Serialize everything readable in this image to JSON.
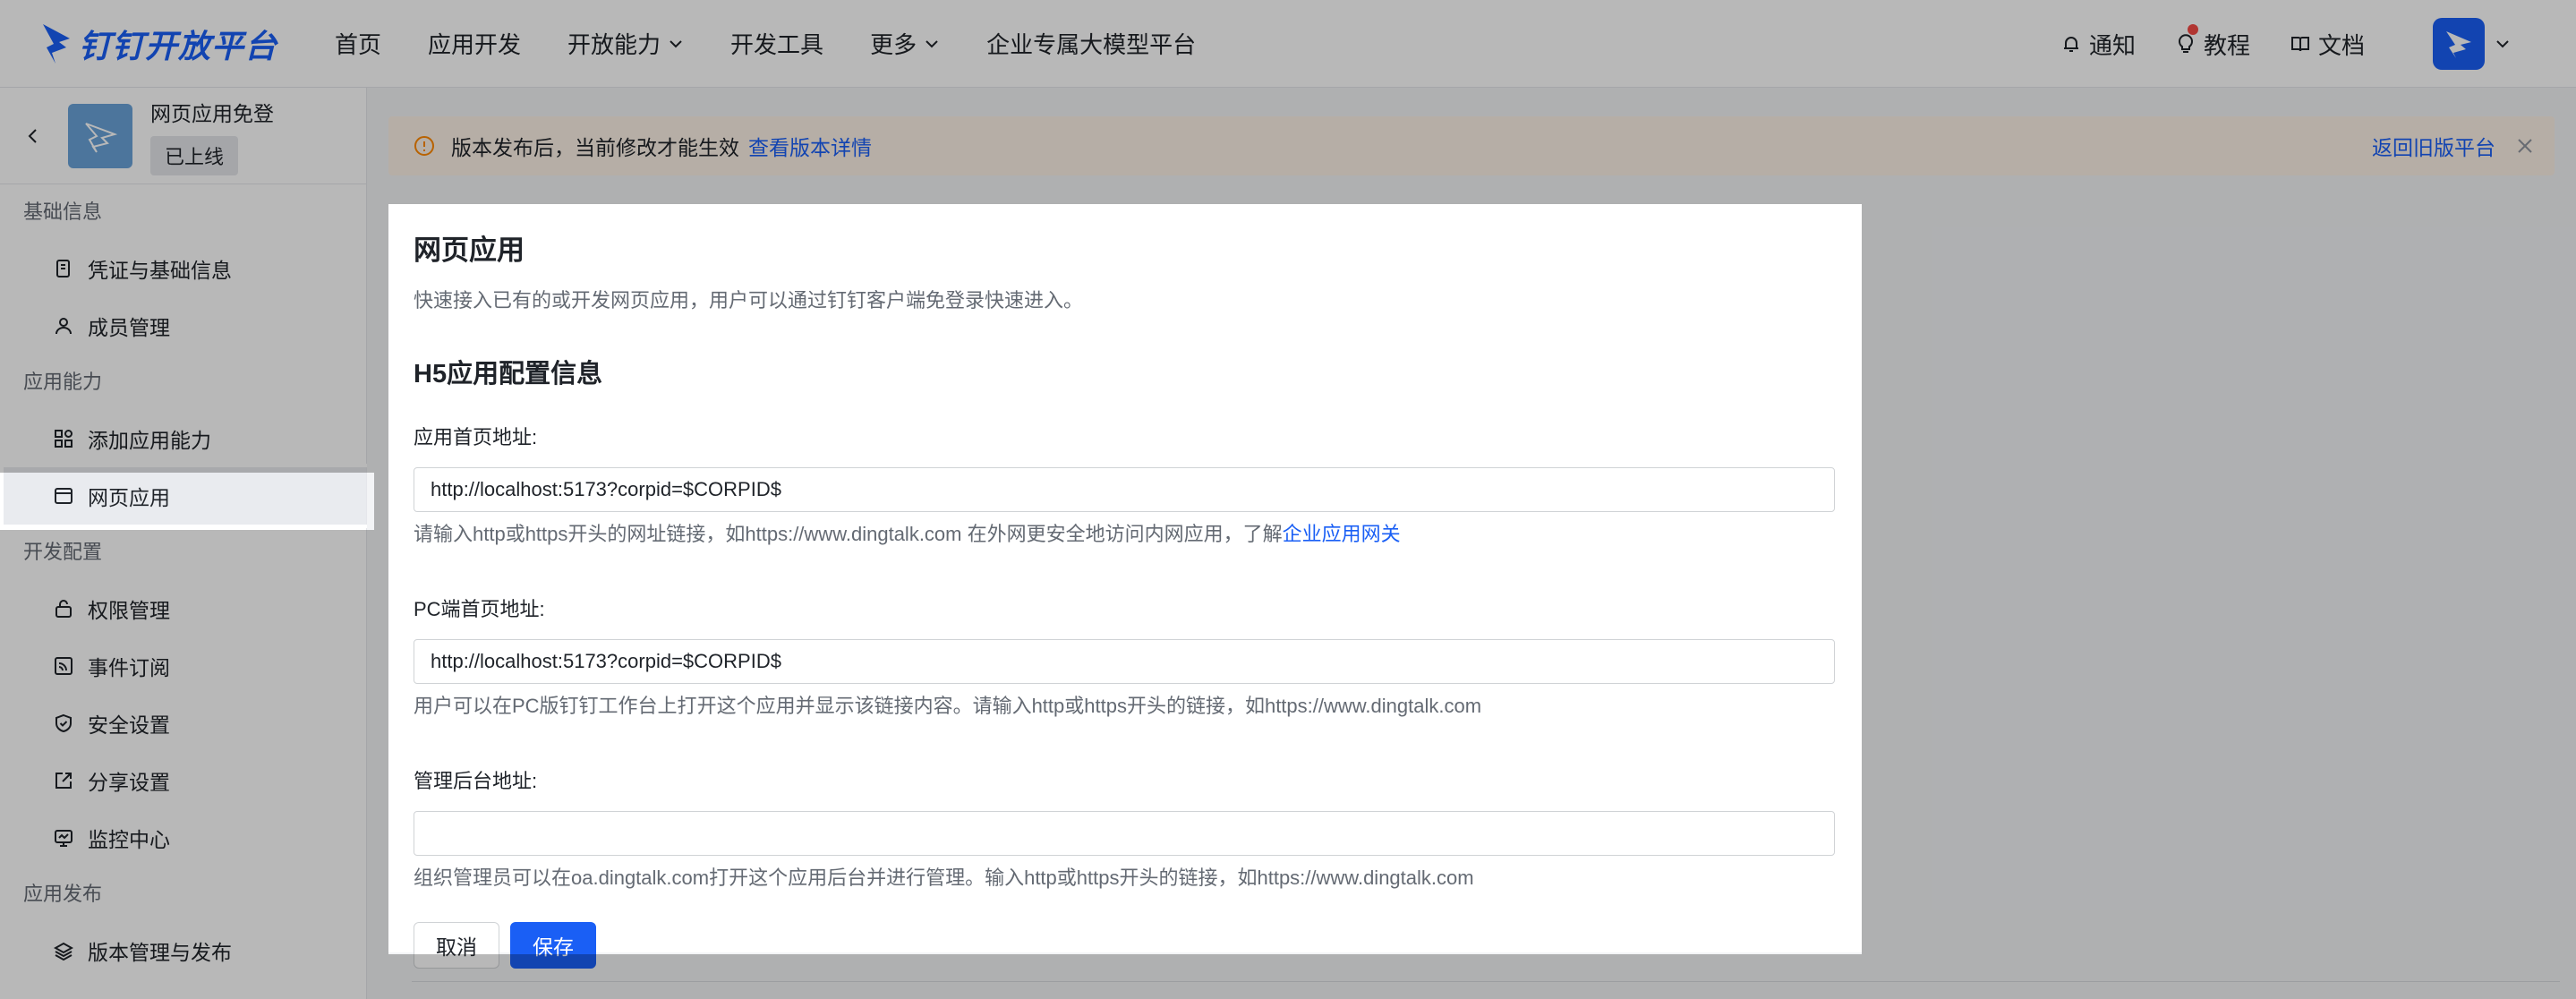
{
  "brand": {
    "name": "钉钉开放平台",
    "color": "#1a5ff5"
  },
  "nav": {
    "items": [
      {
        "label": "首页",
        "has_dropdown": false
      },
      {
        "label": "应用开发",
        "has_dropdown": false
      },
      {
        "label": "开放能力",
        "has_dropdown": true
      },
      {
        "label": "开发工具",
        "has_dropdown": false
      },
      {
        "label": "更多",
        "has_dropdown": true
      },
      {
        "label": "企业专属大模型平台",
        "has_dropdown": false
      }
    ],
    "right": {
      "notify": "通知",
      "tutorial": "教程",
      "docs": "文档"
    }
  },
  "app": {
    "name": "网页应用免登",
    "status": "已上线"
  },
  "sidebar": {
    "groups": [
      {
        "title": "基础信息",
        "items": [
          {
            "label": "凭证与基础信息",
            "icon": "credential-icon"
          },
          {
            "label": "成员管理",
            "icon": "user-icon"
          }
        ]
      },
      {
        "title": "应用能力",
        "items": [
          {
            "label": "添加应用能力",
            "icon": "grid-plus-icon"
          },
          {
            "label": "网页应用",
            "icon": "browser-icon",
            "active": true
          }
        ]
      },
      {
        "title": "开发配置",
        "items": [
          {
            "label": "权限管理",
            "icon": "lock-icon"
          },
          {
            "label": "事件订阅",
            "icon": "rss-icon"
          },
          {
            "label": "安全设置",
            "icon": "shield-icon"
          },
          {
            "label": "分享设置",
            "icon": "share-icon"
          },
          {
            "label": "监控中心",
            "icon": "monitor-icon"
          }
        ]
      },
      {
        "title": "应用发布",
        "items": [
          {
            "label": "版本管理与发布",
            "icon": "layers-icon"
          }
        ]
      }
    ]
  },
  "banner": {
    "text": "版本发布后，当前修改才能生效",
    "link": "查看版本详情",
    "back_link": "返回旧版平台"
  },
  "form": {
    "title": "网页应用",
    "description": "快速接入已有的或开发网页应用，用户可以通过钉钉客户端免登录快速进入。",
    "section_title": "H5应用配置信息",
    "home_url": {
      "label": "应用首页地址:",
      "value": "http://localhost:5173?corpid=$CORPID$",
      "help_prefix": "请输入http或https开头的网址链接，如https://www.dingtalk.com 在外网更安全地访问内网应用，了解",
      "help_link": "企业应用网关"
    },
    "pc_url": {
      "label": "PC端首页地址:",
      "value": "http://localhost:5173?corpid=$CORPID$",
      "help": "用户可以在PC版钉钉工作台上打开这个应用并显示该链接内容。请输入http或https开头的链接，如https://www.dingtalk.com"
    },
    "admin_url": {
      "label": "管理后台地址:",
      "value": "",
      "help": "组织管理员可以在oa.dingtalk.com打开这个应用后台并进行管理。输入http或https开头的链接，如https://www.dingtalk.com"
    },
    "cancel_label": "取消",
    "save_label": "保存"
  },
  "colors": {
    "accent": "#1a5ff5",
    "banner_bg": "#fdf1e6",
    "warning": "#ff8800"
  }
}
